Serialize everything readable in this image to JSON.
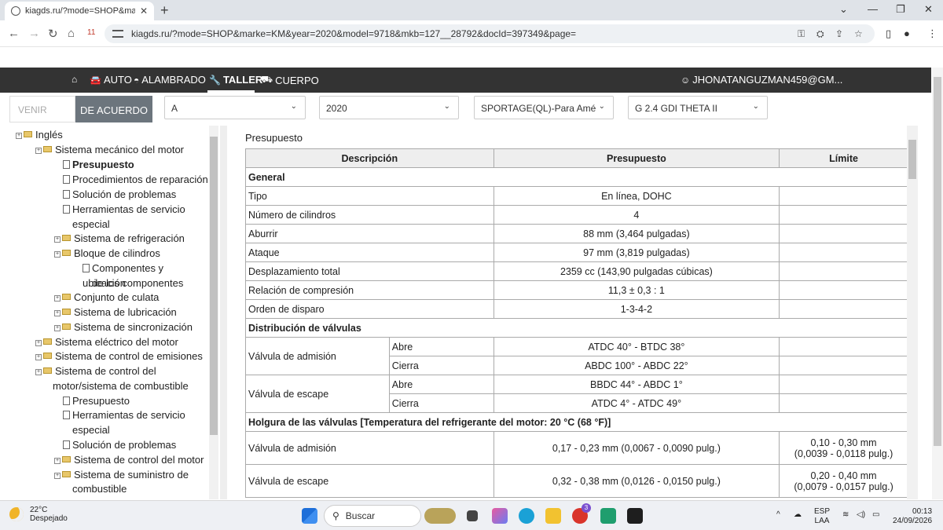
{
  "browser": {
    "tab_title": "kiagds.ru/?mode=SHOP&marke",
    "tab_close": "✕",
    "new_tab": "+",
    "url": "kiagds.ru/?mode=SHOP&marke=KM&year=2020&model=9718&mkb=127__28792&docId=397349&page=",
    "ext_badge": "11"
  },
  "nav": {
    "items": [
      {
        "icon": "⌂",
        "label": ""
      },
      {
        "icon": "🚘",
        "label": "AUTO"
      },
      {
        "icon": "◓",
        "label": "ALAMBRADO"
      },
      {
        "icon": "🔧",
        "label": "TALLER"
      },
      {
        "icon": "⛟",
        "label": "CUERPO"
      }
    ],
    "user": "JHONATANGUZMAN459@GM..."
  },
  "filters": {
    "venir_placeholder": "VENIR",
    "button": "DE ACUERDO",
    "brand": "A",
    "year": "2020",
    "model": "SPORTAGE(QL)-Para Amé",
    "engine": "G 2.4 GDI THETA II"
  },
  "tree": [
    {
      "label": "Inglés",
      "type": "folder",
      "pm": true
    },
    {
      "label": "Sistema mecánico del motor",
      "type": "folder",
      "pm": true
    },
    {
      "label": "Presupuesto",
      "type": "doc",
      "bold": true
    },
    {
      "label": "Procedimientos de reparación",
      "type": "doc"
    },
    {
      "label": "Solución de problemas",
      "type": "doc"
    },
    {
      "label": "Herramientas de servicio",
      "type": "doc"
    },
    {
      "label": "especial",
      "type": "cont"
    },
    {
      "label": "Sistema de refrigeración",
      "type": "folder",
      "pm": true
    },
    {
      "label": "Bloque de cilindros",
      "type": "folder",
      "pm": true
    },
    {
      "label": "Componentes y ubicación",
      "type": "doc"
    },
    {
      "label": "de los componentes",
      "type": "cont"
    },
    {
      "label": "Conjunto de culata",
      "type": "folder",
      "pm": true
    },
    {
      "label": "Sistema de lubricación",
      "type": "folder",
      "pm": true
    },
    {
      "label": "Sistema de sincronización",
      "type": "folder",
      "pm": true
    },
    {
      "label": "Sistema eléctrico del motor",
      "type": "folder",
      "pm": true
    },
    {
      "label": "Sistema de control de emisiones",
      "type": "folder",
      "pm": true
    },
    {
      "label": "Sistema de control del",
      "type": "folder",
      "pm": true
    },
    {
      "label": "motor/sistema de combustible",
      "type": "cont"
    },
    {
      "label": "Presupuesto",
      "type": "doc"
    },
    {
      "label": "Herramientas de servicio",
      "type": "doc"
    },
    {
      "label": "especial",
      "type": "cont"
    },
    {
      "label": "Solución de problemas",
      "type": "doc"
    },
    {
      "label": "Sistema de control del motor",
      "type": "folder",
      "pm": true
    },
    {
      "label": "Sistema de suministro de",
      "type": "folder",
      "pm": true
    },
    {
      "label": "combustible",
      "type": "cont"
    }
  ],
  "content": {
    "title": "Presupuesto",
    "headers": [
      "Descripción",
      "Presupuesto",
      "Límite"
    ],
    "sections": {
      "general": "General",
      "valve_timing": "Distribución de válvulas",
      "valve_clearance": "Holgura de las válvulas [Temperatura del refrigerante del motor: 20 °C (68 °F)]"
    },
    "general_rows": [
      {
        "desc": "Tipo",
        "value": "En línea, DOHC",
        "limit": ""
      },
      {
        "desc": "Número de cilindros",
        "value": "4",
        "limit": ""
      },
      {
        "desc": "Aburrir",
        "value": "88 mm (3,464 pulgadas)",
        "limit": ""
      },
      {
        "desc": "Ataque",
        "value": "97 mm (3,819 pulgadas)",
        "limit": ""
      },
      {
        "desc": "Desplazamiento total",
        "value": "2359 cc (143,90 pulgadas cúbicas)",
        "limit": ""
      },
      {
        "desc": "Relación de compresión",
        "value": "11,3 ± 0,3 : 1",
        "limit": ""
      },
      {
        "desc": "Orden de disparo",
        "value": "1-3-4-2",
        "limit": ""
      }
    ],
    "timing": {
      "intake": "Válvula de admisión",
      "exhaust": "Válvula de escape",
      "opens": "Abre",
      "closes": "Cierra",
      "intake_open": "ATDC 40° - BTDC 38°",
      "intake_close": "ABDC 100° - ABDC 22°",
      "exhaust_open": "BBDC 44° - ABDC 1°",
      "exhaust_close": "ATDC 4° - ATDC 49°"
    },
    "clearance": {
      "intake": "Válvula de admisión",
      "intake_value": "0,17 - 0,23 mm (0,0067 - 0,0090 pulg.)",
      "intake_limit_1": "0,10 - 0,30 mm",
      "intake_limit_2": "(0,0039 - 0,0118 pulg.)",
      "exhaust": "Válvula de escape",
      "exhaust_value": "0,32 - 0,38 mm (0,0126 - 0,0150 pulg.)",
      "exhaust_limit_1": "0,20 - 0,40 mm",
      "exhaust_limit_2": "(0,0079 - 0,0157 pulg.)"
    }
  },
  "taskbar": {
    "temp": "22°C",
    "weather": "Despejado",
    "search": "Buscar",
    "lang1": "ESP",
    "lang2": "LAA",
    "time": "00:13",
    "date": "24/09/2026",
    "badge": "3"
  }
}
